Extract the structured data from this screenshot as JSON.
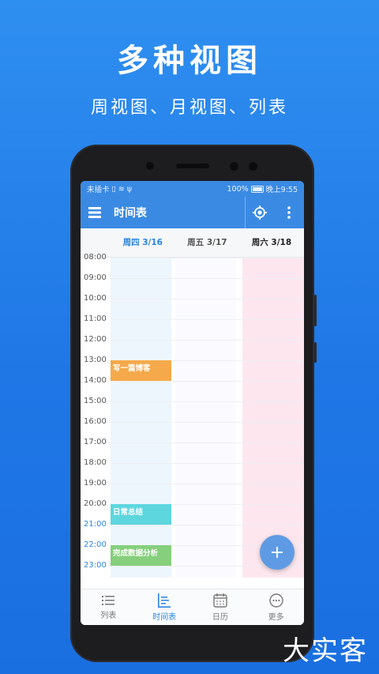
{
  "promo": {
    "headline": "多种视图",
    "subheadline": "周视图、月视图、列表"
  },
  "status_bar": {
    "carrier": "未插卡",
    "battery": "100%",
    "time": "晚上9:55"
  },
  "app_bar": {
    "title": "时间表",
    "menu_icon": "menu-icon",
    "locate_icon": "locate-icon",
    "more_icon": "more-vert-icon"
  },
  "days": [
    {
      "label": "周四 3/16",
      "state": "today"
    },
    {
      "label": "周五 3/17",
      "state": "normal"
    },
    {
      "label": "周六 3/18",
      "state": "weekend"
    }
  ],
  "hours": [
    "08:00",
    "09:00",
    "10:00",
    "11:00",
    "12:00",
    "13:00",
    "14:00",
    "15:00",
    "16:00",
    "17:00",
    "18:00",
    "19:00",
    "20:00",
    "21:00",
    "22:00",
    "23:00"
  ],
  "highlight_hours": [
    "21:00",
    "22:00",
    "23:00"
  ],
  "events": [
    {
      "title": "写一篇博客",
      "day": 0,
      "start": "13:00",
      "end": "14:00",
      "color": "#f5a94a"
    },
    {
      "title": "日常总结",
      "day": 0,
      "start": "20:00",
      "end": "21:00",
      "color": "#5dd6de"
    },
    {
      "title": "完成数据分析",
      "day": 0,
      "start": "22:00",
      "end": "23:00",
      "color": "#86cf7c"
    }
  ],
  "colors": {
    "accent": "#2a84df",
    "appbar": "#3a8ae4",
    "today_column": "#eef6fd",
    "friday_column": "#fbfaff",
    "weekend_column": "#fde6ee"
  },
  "fab": {
    "label": "+"
  },
  "tabs": [
    {
      "label": "列表",
      "icon": "list-icon"
    },
    {
      "label": "时间表",
      "icon": "timeline-icon",
      "active": true
    },
    {
      "label": "日历",
      "icon": "calendar-icon"
    },
    {
      "label": "更多",
      "icon": "more-horiz-icon"
    }
  ],
  "watermark": "大实客"
}
